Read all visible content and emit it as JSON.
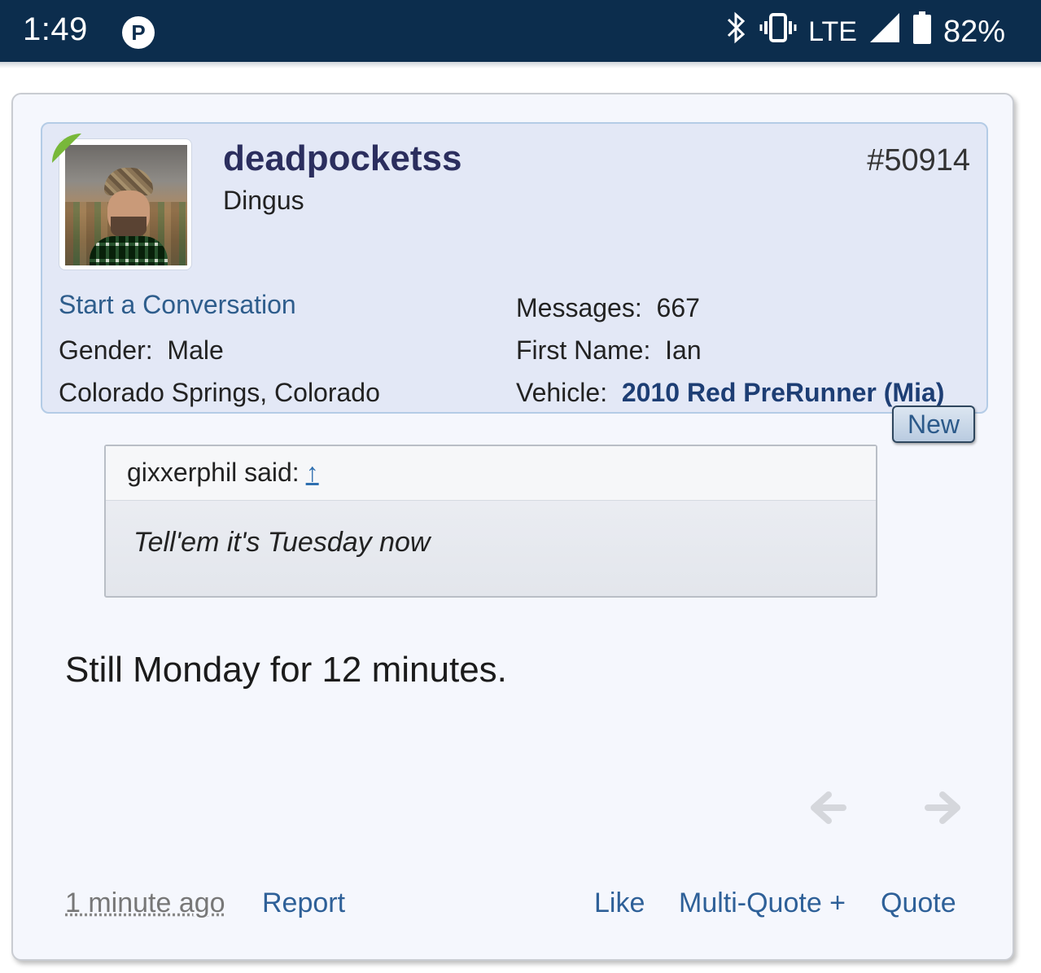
{
  "status_bar": {
    "time": "1:49",
    "app_icon_letter": "P",
    "network": "LTE",
    "battery": "82%"
  },
  "post": {
    "username": "deadpocketss",
    "user_title": "Dingus",
    "post_number": "#50914",
    "start_conversation": "Start a Conversation",
    "info_left": [
      {
        "label": "Gender:",
        "value": "Male"
      },
      {
        "label": "",
        "value": "Colorado Springs, Colorado"
      }
    ],
    "info_right": [
      {
        "label": "Messages:",
        "value": "667"
      },
      {
        "label": "First Name:",
        "value": "Ian"
      },
      {
        "label": "Vehicle:",
        "value": "2010 Red PreRunner (Mia)"
      }
    ],
    "new_badge": "New",
    "quote": {
      "author": "gixxerphil said:",
      "up_arrow": "↑",
      "text": "Tell'em it's Tuesday now"
    },
    "message": "Still Monday for 12 minutes.",
    "footer": {
      "time_ago": "1 minute ago",
      "report": "Report",
      "like": "Like",
      "multi_quote": "Multi-Quote +",
      "quote": "Quote"
    }
  },
  "icons": {
    "bluetooth": "bluetooth-icon",
    "vibrate": "vibrate-icon",
    "signal": "signal-icon",
    "battery": "battery-icon",
    "prev": "arrow-left-icon",
    "next": "arrow-right-icon"
  },
  "colors": {
    "status_bar": "#0c2d4d",
    "username": "#2b2e5e",
    "link": "#2e6098",
    "online": "#78b83a"
  }
}
